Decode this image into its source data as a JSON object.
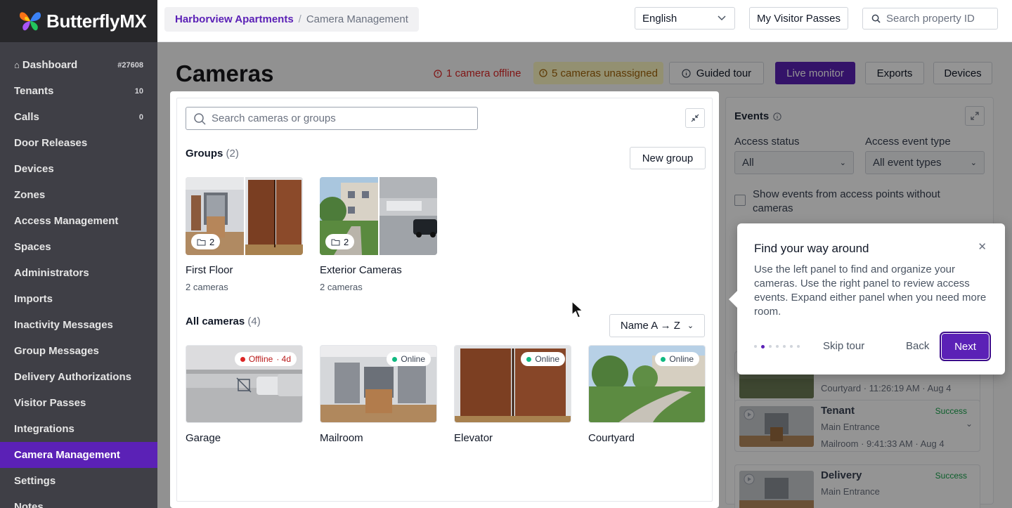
{
  "brand": {
    "name": "ButterflyMX"
  },
  "sidebar": {
    "items": [
      {
        "label": "Dashboard",
        "badge": "#27608",
        "home": true
      },
      {
        "label": "Tenants",
        "badge": "10"
      },
      {
        "label": "Calls",
        "badge": "0"
      },
      {
        "label": "Door Releases",
        "badge": ""
      },
      {
        "label": "Devices",
        "badge": ""
      },
      {
        "label": "Zones",
        "badge": ""
      },
      {
        "label": "Access Management",
        "badge": ""
      },
      {
        "label": "Spaces",
        "badge": ""
      },
      {
        "label": "Administrators",
        "badge": ""
      },
      {
        "label": "Imports",
        "badge": ""
      },
      {
        "label": "Inactivity Messages",
        "badge": ""
      },
      {
        "label": "Group Messages",
        "badge": ""
      },
      {
        "label": "Delivery Authorizations",
        "badge": ""
      },
      {
        "label": "Visitor Passes",
        "badge": ""
      },
      {
        "label": "Integrations",
        "badge": ""
      },
      {
        "label": "Camera Management",
        "badge": "",
        "active": true
      },
      {
        "label": "Settings",
        "badge": ""
      },
      {
        "label": "Notes",
        "badge": ""
      }
    ]
  },
  "topbar": {
    "breadcrumb_property": "Harborview Apartments",
    "breadcrumb_sep": "/",
    "breadcrumb_current": "Camera Management",
    "language": "English",
    "visitor_passes": "My Visitor Passes",
    "search_placeholder": "Search property ID"
  },
  "page": {
    "title": "Cameras",
    "alert_offline": "1 camera offline",
    "alert_unassigned": "5 cameras unassigned",
    "guided_tour": "Guided tour",
    "live_monitor": "Live monitor",
    "exports": "Exports",
    "devices": "Devices"
  },
  "camera_panel": {
    "search_placeholder": "Search cameras or groups",
    "groups_label": "Groups",
    "groups_count": "(2)",
    "new_group": "New group",
    "groups": [
      {
        "name": "First Floor",
        "sub": "2 cameras",
        "count": "2"
      },
      {
        "name": "Exterior Cameras",
        "sub": "2 cameras",
        "count": "2"
      }
    ],
    "all_label": "All cameras",
    "all_count": "(4)",
    "sort": "Name A → Z",
    "cameras": [
      {
        "name": "Garage",
        "status": "Offline",
        "age": "· 4d",
        "status_color": "#dc2626"
      },
      {
        "name": "Mailroom",
        "status": "Online",
        "age": "",
        "status_color": "#10b981"
      },
      {
        "name": "Elevator",
        "status": "Online",
        "age": "",
        "status_color": "#10b981"
      },
      {
        "name": "Courtyard",
        "status": "Online",
        "age": "",
        "status_color": "#10b981"
      }
    ]
  },
  "events_panel": {
    "title": "Events",
    "access_status_label": "Access status",
    "access_status_value": "All",
    "event_type_label": "Access event type",
    "event_type_value": "All event types",
    "checkbox_label": "Show events from access points without cameras",
    "cards": [
      {
        "name": "",
        "status": "",
        "line1": "",
        "line2": "Courtyard · 11:26:19 AM · Aug 4"
      },
      {
        "name": "Tenant",
        "status": "Success",
        "line1": "Main Entrance",
        "line2": "Mailroom · 9:41:33 AM · Aug 4"
      },
      {
        "name": "Delivery",
        "status": "Success",
        "line1": "Main Entrance",
        "line2": ""
      }
    ]
  },
  "tour": {
    "title": "Find your way around",
    "body": "Use the left panel to find and organize your cameras. Use the right panel to review access events. Expand either panel when you need more room.",
    "skip": "Skip tour",
    "back": "Back",
    "next": "Next",
    "step": 2,
    "total_steps": 7
  }
}
